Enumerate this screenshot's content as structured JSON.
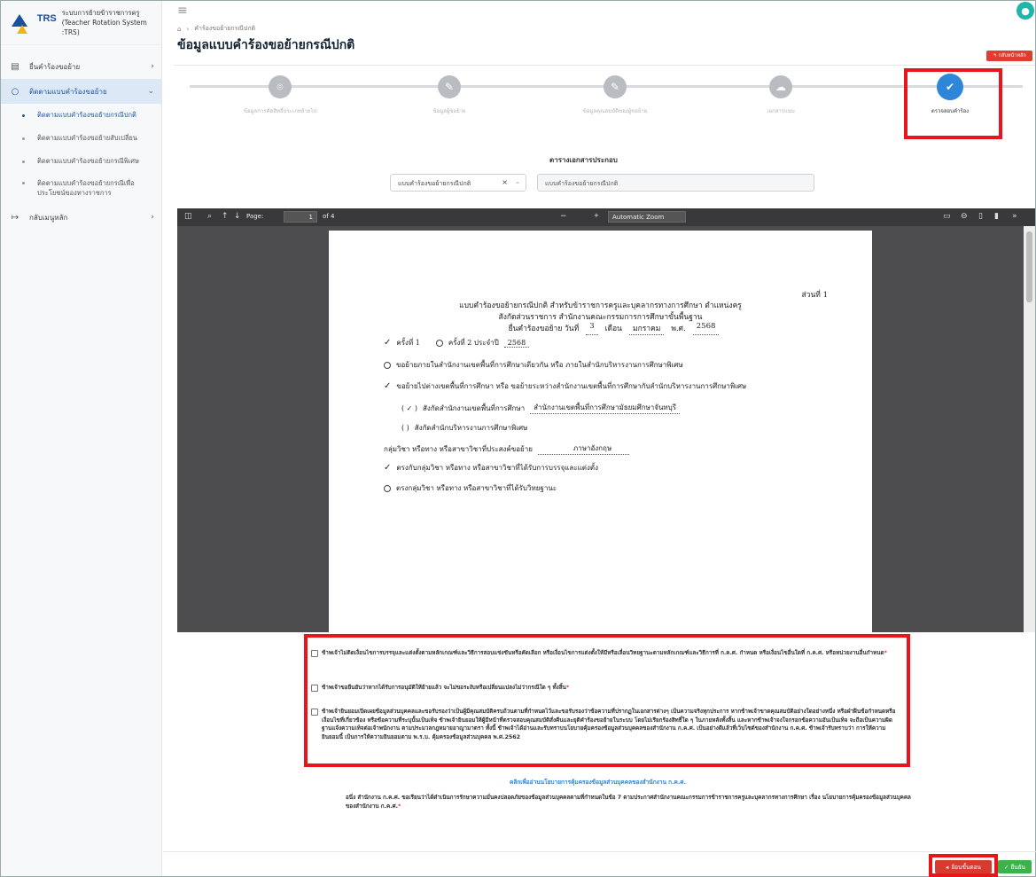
{
  "app": {
    "logo_trs": "TRS",
    "logo_line1": "ระบบการย้ายข้าราชการครู",
    "logo_line2": "(Teacher Rotation System :TRS)"
  },
  "sidebar": {
    "items": [
      {
        "label": "ยื่นคำร้องขอย้าย",
        "icon": "document-icon"
      },
      {
        "label": "ติดตามแบบคำร้องขอย้าย",
        "icon": "search-icon"
      },
      {
        "label": "กลับเมนูหลัก",
        "icon": "logout-icon"
      }
    ],
    "subitems": [
      "ติดตามแบบคำร้องขอย้ายกรณีปกติ",
      "ติดตามแบบคำร้องขอย้ายสับเปลี่ยน",
      "ติดตามแบบคำร้องขอย้ายกรณีพิเศษ",
      "ติดตามแบบคำร้องขอย้ายกรณีเพื่อประโยชน์ของทางราชการ"
    ]
  },
  "header": {
    "breadcrumb": "คำร้องขอย้ายกรณีปกติ",
    "title": "ข้อมูลแบบคำร้องขอย้ายกรณีปกติ",
    "back_label": "↰ กลับหน้าหลัก"
  },
  "stepper": [
    {
      "label": "ข้อมูลการคัดสิทธิ์ประเภทย้ายไป"
    },
    {
      "label": "ข้อมูลผู้ขอย้าย"
    },
    {
      "label": "ข้อมูลคุณสมบัติของผู้ขอย้าย"
    },
    {
      "label": "เอกสารแนบ"
    },
    {
      "label": "ตรวจสอบคำร้อง"
    }
  ],
  "docs": {
    "title": "ตารางเอกสารประกอบ",
    "select_value": "แบบคำร้องขอย้ายกรณีปกติ",
    "input_value": "แบบคำร้องขอย้ายกรณีปกติ"
  },
  "pdf": {
    "page_label": "Page:",
    "page_num": "1",
    "of": "of 4",
    "zoom": "Automatic Zoom",
    "doc": {
      "section": "ส่วนที่ 1",
      "h1": "แบบคำร้องขอย้ายกรณีปกติ สำหรับข้าราชการครูและบุคลากรทางการศึกษา ตำแหน่งครู",
      "h2": "สังกัดส่วนราชการ สำนักงานคณะกรรมการการศึกษาขั้นพื้นฐาน",
      "date_prefix": "ยื่นคำร้องขอย้าย วันที่",
      "day": "3",
      "month_label": "เดือน",
      "month": "มกราคม",
      "year_label": "พ.ศ.",
      "year": "2568",
      "round1": "ครั้งที่ 1",
      "round2": "ครั้งที่ 2 ประจำปี",
      "round_year": "2568",
      "opt1": "ขอย้ายภายในสำนักงานเขตพื้นที่การศึกษาเดียวกัน หรือ ภายในสำนักบริหารงานการศึกษาพิเศษ",
      "opt2": "ขอย้ายไปต่างเขตพื้นที่การศึกษา หรือ ขอย้ายระหว่างสำนักงานเขตพื้นที่การศึกษากับสำนักบริหารงานการศึกษาพิเศษ",
      "mark_check": "( ✓ )",
      "mark_empty": "(    )",
      "sub1_prefix": "สังกัดสำนักงานเขตพื้นที่การศึกษา",
      "sub1_value": "สำนักงานเขตพื้นที่การศึกษามัธยมศึกษาจันทบุรี",
      "sub2": "สังกัดสำนักบริหารงานการศึกษาพิเศษ",
      "subject_prefix": "กลุ่มวิชา หรือทาง หรือสาขาวิชาที่ประสงค์ขอย้าย",
      "subject_value": "ภาษาอังกฤษ",
      "sub_opt1": "ตรงกับกลุ่มวิชา หรือทาง หรือสาขาวิชาที่ได้รับการบรรจุและแต่งตั้ง",
      "sub_opt2": "ตรงกลุ่มวิชา หรือทาง หรือสาขาวิชาที่ได้รับวิทยฐานะ"
    }
  },
  "declarations": [
    "ข้าพเจ้าไม่ติดเงื่อนไขการบรรจุและแต่งตั้งตามหลักเกณฑ์และวิธีการสอบแข่งขันหรือคัดเลือก หรือเงื่อนไขการแต่งตั้งให้มีหรือเลื่อนวิทยฐานะตามหลักเกณฑ์และวิธีการที่ ก.ค.ศ. กำหนด หรือเงื่อนไขอื่นใดที่ ก.ค.ศ. หรือหน่วยงานอื่นกำหนด",
    "ข้าพเจ้าขอยืนยันว่าหากได้รับการอนุมัติให้ย้ายแล้ว จะไม่ขอระงับหรือเปลี่ยนแปลงไม่ว่ากรณีใด ๆ ทั้งสิ้น",
    "ข้าพเจ้ายินยอมเปิดเผยข้อมูลส่วนบุคคลและขอรับรองว่าเป็นผู้มีคุณสมบัติครบถ้วนตามที่กำหนดไว้และขอรับรองว่าข้อความที่ปรากฏในเอกสารต่างๆ เป็นความจริงทุกประการ หากข้าพเจ้าขาดคุณสมบัติอย่างใดอย่างหนึ่ง หรือฝ่าฝืนข้อกำหนดหรือเงื่อนไขที่เกี่ยวข้อง หรือข้อความที่ระบุนั้นเป็นเท็จ ข้าพเจ้ายินยอมให้ผู้มีหน้าที่ตรวจสอบคุณสมบัติสั่งคืนและยุติคำร้องขอย้ายในระบบ โดยไม่เรียกร้องสิทธิ์ใด ๆ ในภายหลังทั้งสิ้น และหากข้าพเจ้าจงใจกรอกข้อความอันเป็นเท็จ จะถือเป็นความผิดฐานแจ้งความเท็จต่อเจ้าพนักงาน ตามประมวลกฎหมายอาญามาตรา ทั้งนี้ ข้าพเจ้าได้อ่านและรับทราบนโยบายคุ้มครองข้อมูลส่วนบุคคลของสำนักงาน ก.ค.ศ. เป็นอย่างดีแล้วที่เว็บไซต์ของสำนักงาน ก.ค.ศ. ข้าพเจ้ารับทราบว่า การให้ความยินยอมนี้ เป็นการให้ความยินยอมตาม พ.ร.บ. คุ้มครองข้อมูลส่วนบุคคล พ.ศ.2562"
  ],
  "policy_link": "คลิกเพื่ออ่านนโยบายการคุ้มครองข้อมูลส่วนบุคคลของสำนักงาน ก.ค.ศ.",
  "consent": "อนึ่ง สำนักงาน ก.ค.ศ. ขอเรียนว่าได้ดำเนินการรักษาความมั่นคงปลอดภัยของข้อมูลส่วนบุคคลตามที่กำหนดในข้อ 7 ตามประกาศสำนักงานคณะกรรมการข้าราชการครูและบุคลากรทางการศึกษา เรื่อง นโยบายการคุ้มครองข้อมูลส่วนบุคคลของสำนักงาน ก.ค.ศ.",
  "buttons": {
    "back": "ย้อนขั้นตอน",
    "confirm": "ยืนยัน"
  },
  "colors": {
    "primary": "#2e86d8",
    "danger": "#d93a2f",
    "success": "#3bb34a",
    "highlight": "#e8151b"
  }
}
